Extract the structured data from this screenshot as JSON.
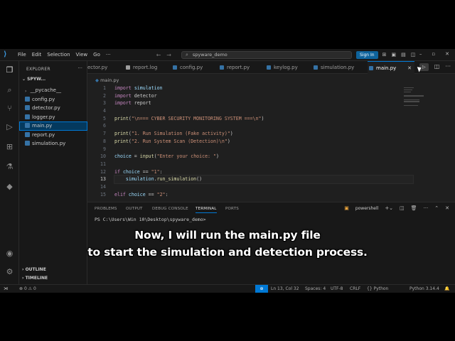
{
  "menu": [
    "File",
    "Edit",
    "Selection",
    "View",
    "Go"
  ],
  "titlebar": {
    "more": "···",
    "search_text": "spyware_demo",
    "signin": "Sign In"
  },
  "sidebar": {
    "title": "EXPLORER",
    "root": "SPYW...",
    "files": [
      {
        "name": "__pycache__",
        "type": "folder",
        "selected": false
      },
      {
        "name": "config.py",
        "type": "py",
        "selected": false
      },
      {
        "name": "detector.py",
        "type": "py",
        "selected": false
      },
      {
        "name": "logger.py",
        "type": "py",
        "selected": false
      },
      {
        "name": "main.py",
        "type": "py",
        "selected": true
      },
      {
        "name": "report.py",
        "type": "py",
        "selected": false
      },
      {
        "name": "simulation.py",
        "type": "py",
        "selected": false
      }
    ],
    "outline": "OUTLINE",
    "timeline": "TIMELINE"
  },
  "tabs": [
    {
      "label": "ector.py",
      "icon_color": "#3572a5"
    },
    {
      "label": "report.log",
      "icon_color": "#9d9d9d"
    },
    {
      "label": "config.py",
      "icon_color": "#3572a5"
    },
    {
      "label": "report.py",
      "icon_color": "#3572a5"
    },
    {
      "label": "keylog.py",
      "icon_color": "#3572a5"
    },
    {
      "label": "simulation.py",
      "icon_color": "#3572a5"
    },
    {
      "label": "main.py",
      "icon_color": "#3572a5",
      "active": true
    }
  ],
  "breadcrumb": "main.py",
  "editor": {
    "line_numbers": [
      "1",
      "2",
      "3",
      "4",
      "5",
      "6",
      "7",
      "8",
      "9",
      "10",
      "11",
      "12",
      "13",
      "14",
      "15"
    ],
    "current_line": "13",
    "lines": [
      "import simulation",
      "import detector",
      "import report",
      "",
      "print(\"\\n=== CYBER SECURITY MONITORING SYSTEM ===\\n\")",
      "",
      "print(\"1. Run Simulation (Fake activity)\")",
      "print(\"2. Run System Scan (Detection)\\n\")",
      "",
      "choice = input(\"Enter your choice: \")",
      "",
      "if choice == \"1\":",
      "    simulation.run_simulation()",
      "",
      "elif choice == \"2\":"
    ]
  },
  "panel": {
    "tabs": [
      "PROBLEMS",
      "OUTPUT",
      "DEBUG CONSOLE",
      "TERMINAL",
      "PORTS"
    ],
    "active_tab": "TERMINAL",
    "shell": "powershell",
    "terminal_prompt": "PS C:\\Users\\Win 10\\Desktop\\spyware_demo> "
  },
  "status": {
    "errors": "0",
    "warnings": "0",
    "position": "Ln 13, Col 32",
    "spaces": "Spaces: 4",
    "encoding": "UTF-8",
    "eol": "CRLF",
    "language": "Python",
    "interpreter": "Python 3.14.4"
  },
  "caption": {
    "line1": "Now, I will run the main.py file",
    "line2": "to start the simulation and detection process."
  }
}
